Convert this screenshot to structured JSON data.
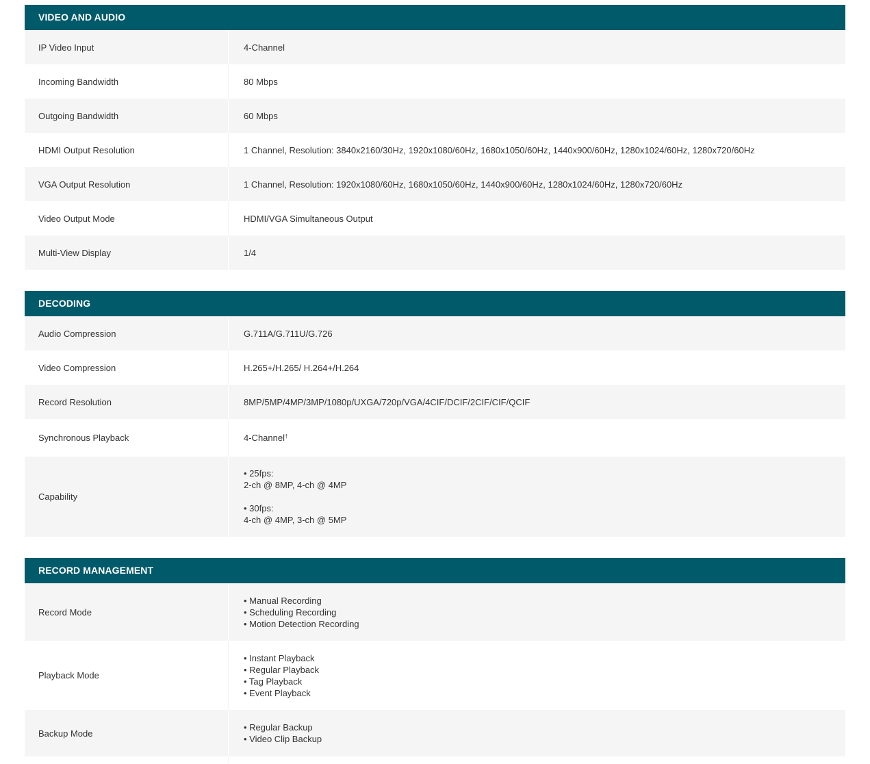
{
  "sections": [
    {
      "title": "VIDEO AND AUDIO",
      "rows": [
        {
          "label": "IP Video Input",
          "value": "4-Channel"
        },
        {
          "label": "Incoming Bandwidth",
          "value": "80 Mbps"
        },
        {
          "label": "Outgoing Bandwidth",
          "value": "60 Mbps"
        },
        {
          "label": "HDMI Output Resolution",
          "value": "1 Channel, Resolution: 3840x2160/30Hz, 1920x1080/60Hz, 1680x1050/60Hz, 1440x900/60Hz, 1280x1024/60Hz, 1280x720/60Hz"
        },
        {
          "label": "VGA Output Resolution",
          "value": "1 Channel, Resolution: 1920x1080/60Hz, 1680x1050/60Hz, 1440x900/60Hz, 1280x1024/60Hz, 1280x720/60Hz"
        },
        {
          "label": "Video Output Mode",
          "value": "HDMI/VGA Simultaneous Output"
        },
        {
          "label": "Multi-View Display",
          "value": "1/4"
        }
      ]
    },
    {
      "title": "DECODING",
      "rows": [
        {
          "label": "Audio Compression",
          "value": "G.711A/G.711U/G.726"
        },
        {
          "label": "Video Compression",
          "value": "H.265+/H.265/ H.264+/H.264"
        },
        {
          "label": "Record Resolution",
          "value": "8MP/5MP/4MP/3MP/1080p/UXGA/720p/VGA/4CIF/DCIF/2CIF/CIF/QCIF"
        },
        {
          "label": "Synchronous Playback",
          "value": "4-Channel",
          "sup": "†"
        },
        {
          "label": "Capability",
          "lines": [
            "• 25fps:",
            "2-ch @ 8MP, 4-ch @ 4MP",
            "",
            "• 30fps:",
            "4-ch @ 4MP, 3-ch @ 5MP"
          ]
        }
      ]
    },
    {
      "title": "RECORD MANAGEMENT",
      "rows": [
        {
          "label": "Record Mode",
          "lines": [
            "• Manual Recording",
            "• Scheduling Recording",
            "• Motion Detection Recording"
          ]
        },
        {
          "label": "Playback Mode",
          "lines": [
            "• Instant Playback",
            "• Regular Playback",
            "• Tag Playback",
            "• Event Playback"
          ]
        },
        {
          "label": "Backup Mode",
          "lines": [
            "• Regular Backup",
            "• Video Clip Backup"
          ]
        }
      ]
    }
  ]
}
